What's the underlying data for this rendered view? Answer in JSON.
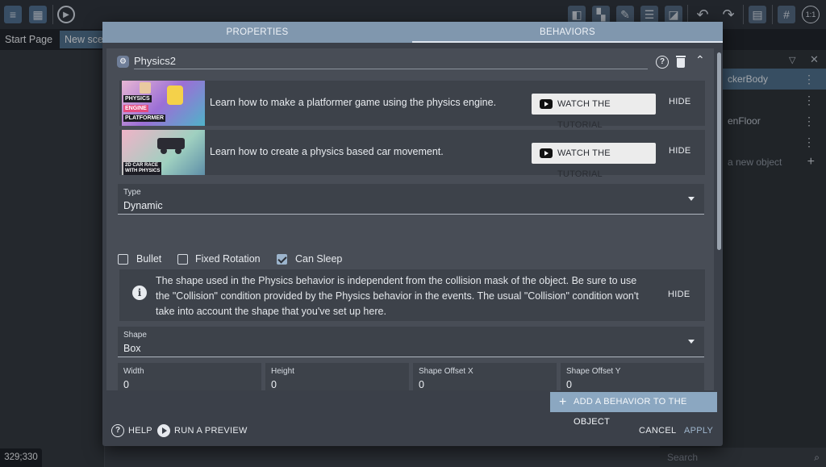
{
  "toolbar": {
    "icons": [
      "project-manager-icon",
      "scene-properties-icon",
      "preview-icon",
      "toggle-object-list-icon",
      "toggle-instances-icon",
      "toggle-properties-icon",
      "toggle-layers-icon",
      "toggle-grid-icon",
      "undo-icon",
      "redo-icon",
      "grid-settings-icon",
      "grid-icon",
      "zoom-reset-icon"
    ],
    "zoom_label": "1:1"
  },
  "page_tabs": [
    {
      "label": "Start Page"
    },
    {
      "label": "New sce"
    }
  ],
  "objects_panel": {
    "rows": [
      {
        "label": "ckerBody"
      },
      {
        "label": ""
      },
      {
        "label": "enFloor"
      },
      {
        "label": ""
      },
      {
        "label": "a new object"
      }
    ],
    "search_placeholder": "Search"
  },
  "coordinates": "329;330",
  "dialog": {
    "tabs": [
      "PROPERTIES",
      "BEHAVIORS"
    ],
    "active_tab": "BEHAVIORS",
    "behavior": {
      "name": "Physics2",
      "tutorials": [
        {
          "text": "Learn how to make a platformer game using the physics engine.",
          "thumb_caption": [
            "PHYSICS",
            "ENGINE",
            "PLATFORMER"
          ],
          "button": "WATCH THE TUTORIAL",
          "hide": "HIDE"
        },
        {
          "text": "Learn how to create a physics based car movement.",
          "thumb_caption": [
            "2D CAR RACE",
            "WITH PHYSICS"
          ],
          "button": "WATCH THE TUTORIAL",
          "hide": "HIDE"
        }
      ],
      "type_field": {
        "label": "Type",
        "value": "Dynamic"
      },
      "checkboxes": [
        {
          "label": "Bullet",
          "checked": false
        },
        {
          "label": "Fixed Rotation",
          "checked": false
        },
        {
          "label": "Can Sleep",
          "checked": true
        }
      ],
      "info": {
        "text": "The shape used in the Physics behavior is independent from the collision mask of the object. Be sure to use the \"Collision\" condition provided by the Physics behavior in the events. The usual \"Collision\" condition won't take into account the shape that you've set up here.",
        "hide": "HIDE"
      },
      "shape_field": {
        "label": "Shape",
        "value": "Box"
      },
      "dimension_fields": [
        {
          "label": "Width",
          "value": "0"
        },
        {
          "label": "Height",
          "value": "0"
        },
        {
          "label": "Shape Offset X",
          "value": "0"
        },
        {
          "label": "Shape Offset Y",
          "value": "0"
        }
      ]
    },
    "add_behavior_label": "ADD A BEHAVIOR TO THE OBJECT",
    "help_label": "HELP",
    "preview_label": "RUN A PREVIEW",
    "cancel_label": "CANCEL",
    "apply_label": "APPLY"
  },
  "colors": {
    "dialog_bg": "#3b4049",
    "tab_bar": "#8097ae",
    "accent_button": "#8ba7c1",
    "checkbox_checked": "#9cb4cc"
  }
}
